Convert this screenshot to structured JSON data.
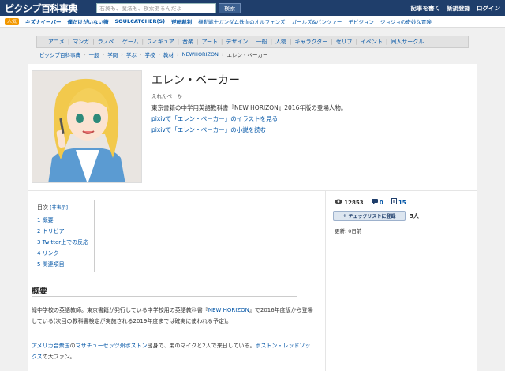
{
  "header": {
    "logo": "ピクシブ百科事典",
    "search_placeholder": "右翼も、魔法も、検索あるんだよ",
    "search_button": "検索",
    "links": [
      "記事を書く",
      "新規登録",
      "ログイン"
    ]
  },
  "hotbar": {
    "badge": "人気",
    "items": [
      "キズナイーバー",
      "僕だけがいない街",
      "SOULCATCHER(S)",
      "逆転裁判",
      "機動戦士ガンダム鉄血のオルフェンズ",
      "ガールズ&パンツァー",
      "デビジョン",
      "ジョジョの奇妙な冒険"
    ]
  },
  "categories": [
    "アニメ",
    "マンガ",
    "ラノベ",
    "ゲーム",
    "フィギュア",
    "音楽",
    "アート",
    "デザイン",
    "一般",
    "人物",
    "キャラクター",
    "セリフ",
    "イベント",
    "同人サークル"
  ],
  "breadcrumbs": [
    "ピクシブ百科事典",
    "一般",
    "学問",
    "学ぶ",
    "学校",
    "教材",
    "NEWHORIZON",
    "エレン・ベーカー"
  ],
  "article": {
    "title": "エレン・ベーカー",
    "reading": "えれんべーかー",
    "description": "東京書籍の中学用英語教科書『NEW HORIZON』2016年版の登場人物。",
    "link_illust": "pixivで「エレン・ベーカー」のイラストを見る",
    "link_novel": "pixivで「エレン・ベーカー」の小説を読む"
  },
  "toc": {
    "label": "目次",
    "hide": "[非表示]",
    "items": [
      "1 概要",
      "2 トリビア",
      "3 Twitter上での反応",
      "4 リンク",
      "5 関連項目"
    ]
  },
  "stats": {
    "views": "12853",
    "comments": "0",
    "likes": "15",
    "checklist_button": "チェックリストに登録",
    "checklist_count": "5人",
    "updated": "更新: 0日前"
  },
  "summary": {
    "heading": "概要",
    "p1_a": "緑中学校の英語教師。東京書籍が発行している中学校用の英語教科書『",
    "p1_link": "NEW HORIZON",
    "p1_b": "』で2016年度版から登場している(次回の教科書検定が実施される2019年度までは確実に使われる予定)。",
    "p2_l1": "アメリカ合衆国",
    "p2_t1": "の",
    "p2_l2": "マサチューセッツ州",
    "p2_l3": "ボストン",
    "p2_t2": "出身で、弟のマイクと2人で来日している。",
    "p2_l4": "ボストン・レッドソックス",
    "p2_t3": "の大ファン。"
  },
  "colors": {
    "header_bg": "#1f3e6b",
    "link": "#0054a6",
    "hot_badge": "#f39800"
  }
}
